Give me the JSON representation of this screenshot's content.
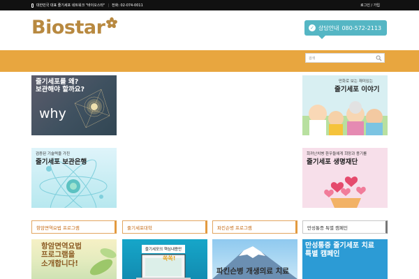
{
  "topbar": {
    "tagline": "대한민국 대표 줄기세포 네트워크 \"바이오스타\"",
    "phone": "전화: 02-074-0011",
    "auth": "로그인 / 가입"
  },
  "logo": {
    "text": "Biostar"
  },
  "header": {
    "call_label": "상담안내",
    "call_number": "080-572-2113"
  },
  "search": {
    "placeholder": "검색"
  },
  "banners": {
    "why": {
      "title_line1": "줄기세포를 왜?",
      "title_line2": "보관해야 할까요?",
      "word": "why"
    },
    "story": {
      "sub": "만화로 보는 재미있는",
      "title": "줄기세포 이야기"
    },
    "bank": {
      "sub": "검증된 기술력을 가진",
      "title": "줄기세포 보관은행"
    },
    "foundation": {
      "sub": "희귀난치병 환우들에게 희망과 용기를",
      "title": "줄기세포 생명재단"
    }
  },
  "tabs": [
    {
      "label": "항암면역요법 프로그램"
    },
    {
      "label": "줄기세포대학"
    },
    {
      "label": "파킨슨병 프로그램"
    },
    {
      "label": "만성통증 특별 캠페인"
    }
  ],
  "bottom": {
    "immune": {
      "line1": "항암면역요법",
      "line2": "프로그램을",
      "line3": "소개합니다!"
    },
    "univ": {
      "caption": "줄기세포의 핵심내용만",
      "badge": "쏙쏙!"
    },
    "park": {
      "title": "파킨슨병 개생의료 치료"
    },
    "pain": {
      "line1": "만성통증 줄기세포 치료",
      "line2": "특별 캠페인"
    }
  },
  "colors": {
    "brand": "#b88940",
    "nav": "#e8a63f",
    "call": "#55b6c4",
    "tab_border": "#e39a3f"
  }
}
